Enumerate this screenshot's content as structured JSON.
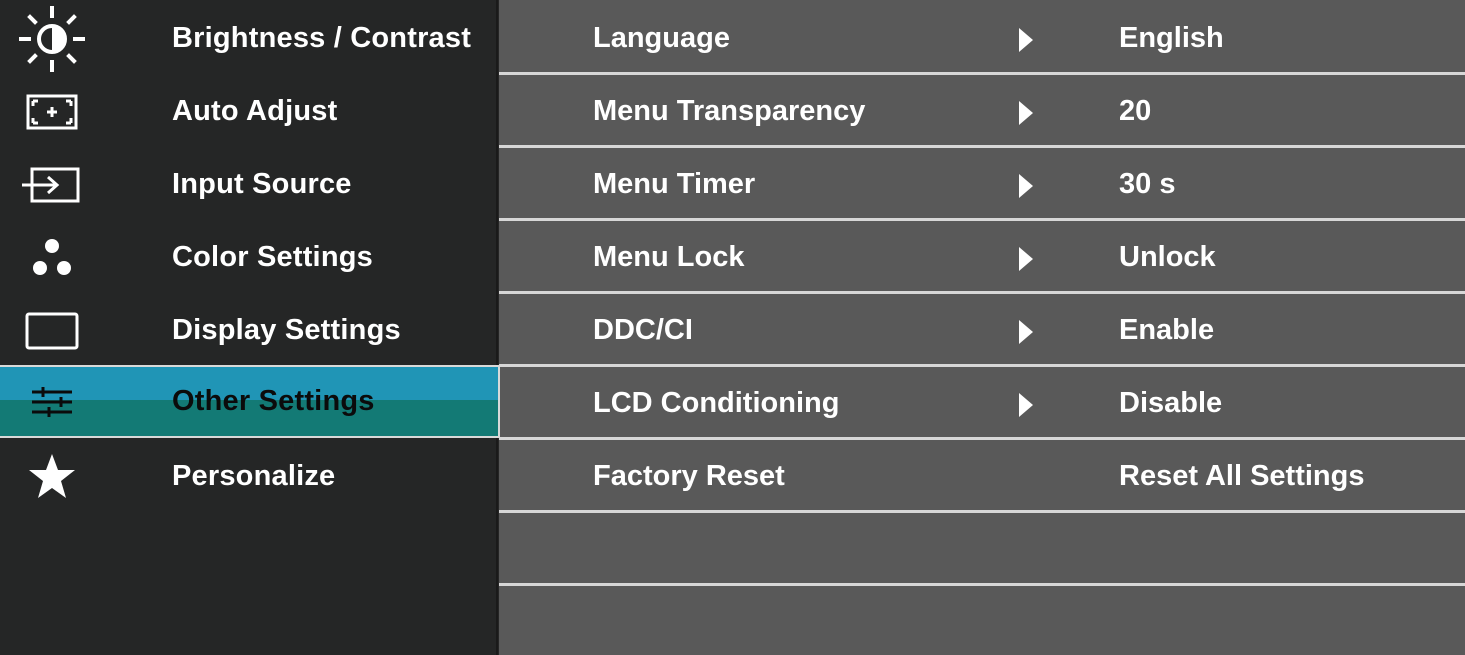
{
  "sidebar": {
    "items": [
      {
        "label": "Brightness / Contrast",
        "icon": "brightness-icon"
      },
      {
        "label": "Auto Adjust",
        "icon": "auto-adjust-icon"
      },
      {
        "label": "Input Source",
        "icon": "input-source-icon"
      },
      {
        "label": "Color Settings",
        "icon": "color-settings-icon"
      },
      {
        "label": "Display Settings",
        "icon": "display-settings-icon"
      },
      {
        "label": "Other Settings",
        "icon": "sliders-icon",
        "selected": true
      },
      {
        "label": "Personalize",
        "icon": "star-icon"
      }
    ]
  },
  "main": {
    "rows": [
      {
        "name": "Language",
        "value": "English",
        "has_arrow": true
      },
      {
        "name": "Menu Transparency",
        "value": "20",
        "has_arrow": true
      },
      {
        "name": "Menu Timer",
        "value": "30 s",
        "has_arrow": true
      },
      {
        "name": "Menu Lock",
        "value": "Unlock",
        "has_arrow": true
      },
      {
        "name": "DDC/CI",
        "value": "Enable",
        "has_arrow": true
      },
      {
        "name": "LCD Conditioning",
        "value": "Disable",
        "has_arrow": true
      },
      {
        "name": "Factory Reset",
        "value": "Reset All Settings",
        "has_arrow": false
      },
      {
        "name": "",
        "value": "",
        "has_arrow": false
      },
      {
        "name": "",
        "value": "",
        "has_arrow": false
      }
    ]
  },
  "colors": {
    "sidebar_bg": "#252626",
    "main_bg": "#595959",
    "selected_top": "#2095b6",
    "selected_bottom": "#137a75",
    "divider": "#d7d7d7"
  }
}
